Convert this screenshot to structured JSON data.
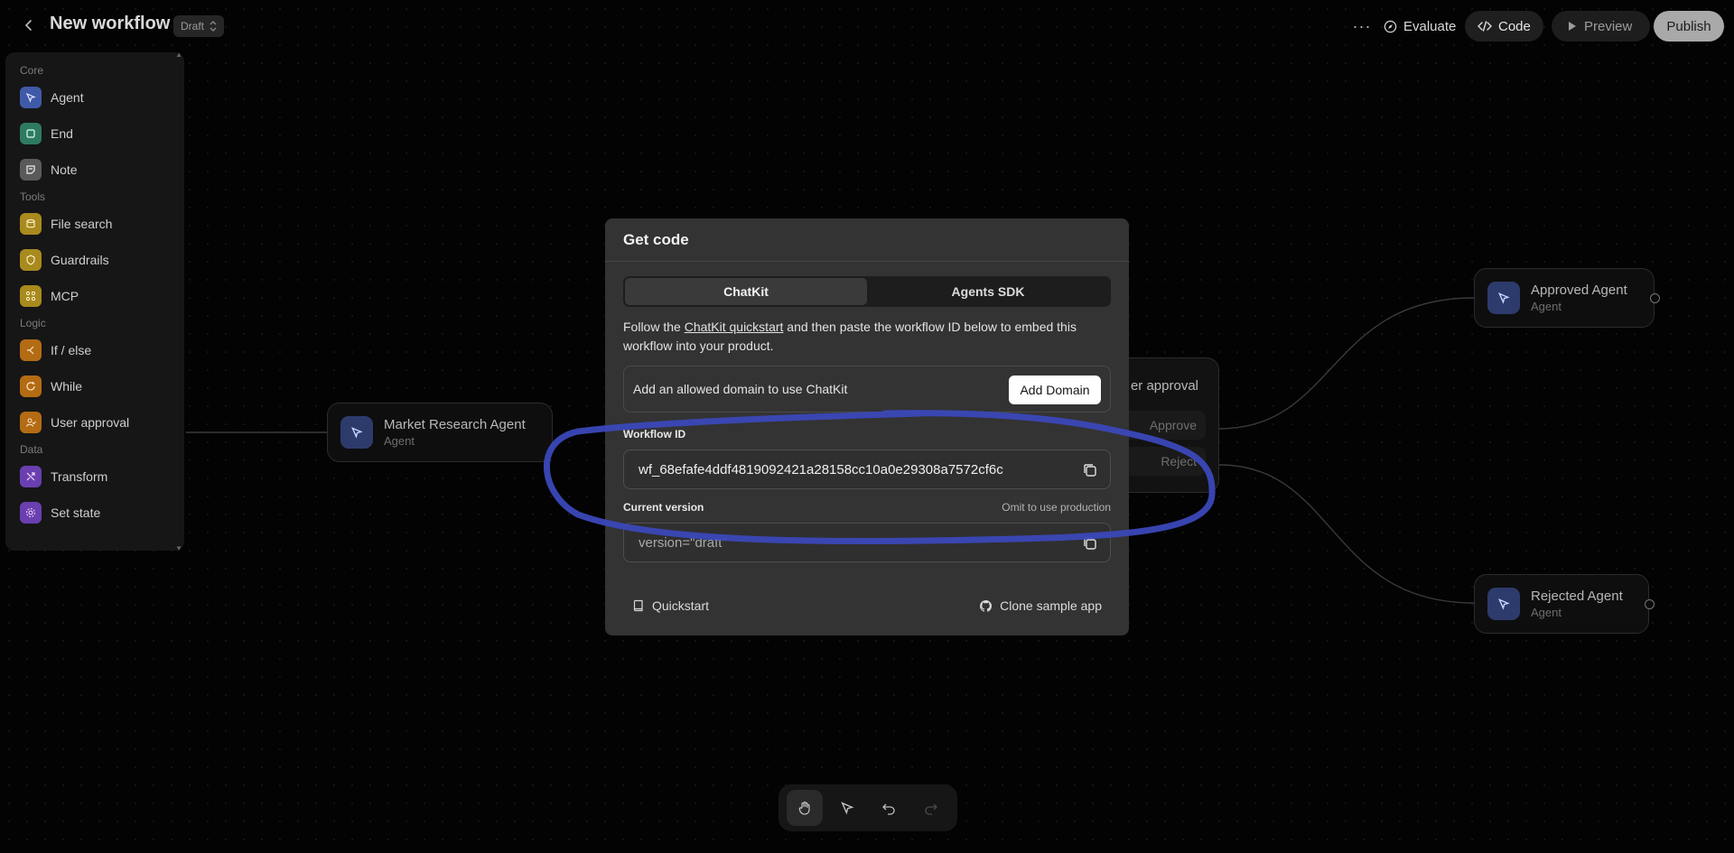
{
  "header": {
    "title": "New workflow",
    "draft_label": "Draft",
    "more_label": "···",
    "evaluate_label": "Evaluate",
    "code_label": "Code",
    "preview_label": "Preview",
    "publish_label": "Publish"
  },
  "sidebar": {
    "sections": [
      {
        "label": "Core",
        "items": [
          {
            "label": "Agent",
            "icon": "agent-icon",
            "color": "#3f5aa8"
          },
          {
            "label": "End",
            "icon": "end-icon",
            "color": "#2f7a62"
          },
          {
            "label": "Note",
            "icon": "note-icon",
            "color": "#5a5a5a"
          }
        ]
      },
      {
        "label": "Tools",
        "items": [
          {
            "label": "File search",
            "icon": "file-search-icon",
            "color": "#a88a1e"
          },
          {
            "label": "Guardrails",
            "icon": "guardrails-icon",
            "color": "#a88a1e"
          },
          {
            "label": "MCP",
            "icon": "mcp-icon",
            "color": "#a88a1e"
          }
        ]
      },
      {
        "label": "Logic",
        "items": [
          {
            "label": "If / else",
            "icon": "if-else-icon",
            "color": "#b36b14"
          },
          {
            "label": "While",
            "icon": "while-icon",
            "color": "#b36b14"
          },
          {
            "label": "User approval",
            "icon": "user-approval-icon",
            "color": "#b36b14"
          }
        ]
      },
      {
        "label": "Data",
        "items": [
          {
            "label": "Transform",
            "icon": "transform-icon",
            "color": "#6a3fb0"
          },
          {
            "label": "Set state",
            "icon": "set-state-icon",
            "color": "#6a3fb0"
          }
        ]
      }
    ]
  },
  "canvas": {
    "market_agent": {
      "title": "Market Research Agent",
      "sub": "Agent"
    },
    "approved_agent": {
      "title": "Approved Agent",
      "sub": "Agent"
    },
    "rejected_agent": {
      "title": "Rejected Agent",
      "sub": "Agent"
    },
    "user_approval": {
      "title": "er approval",
      "approve": "Approve",
      "reject": "Reject"
    }
  },
  "modal": {
    "title": "Get code",
    "tabs": [
      "ChatKit",
      "Agents SDK"
    ],
    "active_tab": "ChatKit",
    "desc_prefix": "Follow the ",
    "desc_link": "ChatKit quickstart",
    "desc_suffix": " and then paste the workflow ID below to embed this workflow into your product.",
    "domain_text": "Add an allowed domain to use ChatKit",
    "add_domain_label": "Add Domain",
    "workflow_id_label": "Workflow ID",
    "workflow_id_value": "wf_68efafe4ddf4819092421a28158cc10a0e29308a7572cf6c",
    "current_version_label": "Current version",
    "current_version_hint": "Omit to use production",
    "current_version_value": "version=\"draft\"",
    "quickstart_label": "Quickstart",
    "clone_label": "Clone sample app"
  },
  "colors": {
    "annotation": "#3b48b8",
    "accent_agent": "#2d3b6c"
  }
}
